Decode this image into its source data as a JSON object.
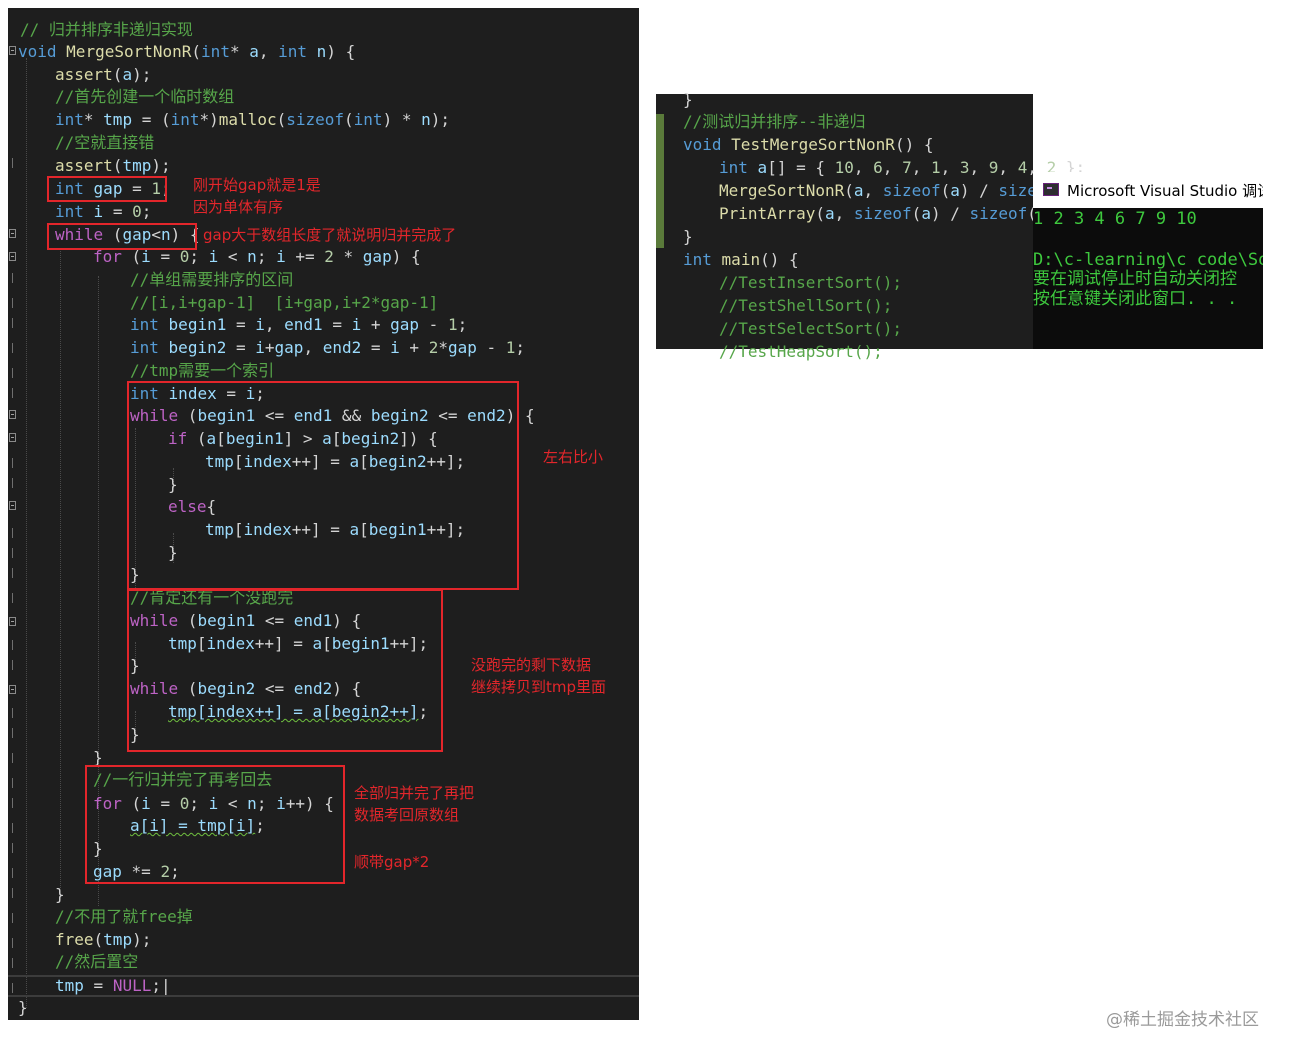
{
  "left_editor": {
    "lines": [
      {
        "parts": [
          [
            "cm",
            "// 归并排序非递归实现"
          ]
        ]
      },
      {
        "parts": [
          [
            "kw",
            "void"
          ],
          [
            "op",
            " "
          ],
          [
            "fn",
            "MergeSortNonR"
          ],
          [
            "op",
            "("
          ],
          [
            "kw",
            "int"
          ],
          [
            "op",
            "* "
          ],
          [
            "var",
            "a"
          ],
          [
            "op",
            ", "
          ],
          [
            "kw",
            "int"
          ],
          [
            "op",
            " "
          ],
          [
            "var",
            "n"
          ],
          [
            "op",
            ") {"
          ]
        ]
      },
      {
        "parts": [
          [
            "fn",
            "assert"
          ],
          [
            "op",
            "("
          ],
          [
            "var",
            "a"
          ],
          [
            "op",
            ");"
          ]
        ]
      },
      {
        "parts": [
          [
            "cm",
            "//首先创建一个临时数组"
          ]
        ]
      },
      {
        "parts": [
          [
            "kw",
            "int"
          ],
          [
            "op",
            "* "
          ],
          [
            "var",
            "tmp"
          ],
          [
            "op",
            " = ("
          ],
          [
            "kw",
            "int"
          ],
          [
            "op",
            "*)"
          ],
          [
            "fn",
            "malloc"
          ],
          [
            "op",
            "("
          ],
          [
            "kw",
            "sizeof"
          ],
          [
            "op",
            "("
          ],
          [
            "kw",
            "int"
          ],
          [
            "op",
            ") * "
          ],
          [
            "var",
            "n"
          ],
          [
            "op",
            ");"
          ]
        ]
      },
      {
        "parts": [
          [
            "cm",
            "//空就直接错"
          ]
        ]
      },
      {
        "parts": [
          [
            "fn",
            "assert"
          ],
          [
            "op",
            "("
          ],
          [
            "var",
            "tmp"
          ],
          [
            "op",
            ");"
          ]
        ]
      },
      {
        "parts": [
          [
            "kw",
            "int"
          ],
          [
            "op",
            " "
          ],
          [
            "var",
            "gap"
          ],
          [
            "op",
            " = "
          ],
          [
            "num",
            "1"
          ],
          [
            "op",
            ";"
          ]
        ]
      },
      {
        "parts": [
          [
            "kw",
            "int"
          ],
          [
            "op",
            " "
          ],
          [
            "var",
            "i"
          ],
          [
            "op",
            " = "
          ],
          [
            "num",
            "0"
          ],
          [
            "op",
            ";"
          ]
        ]
      },
      {
        "parts": [
          [
            "mac",
            "while"
          ],
          [
            "op",
            " ("
          ],
          [
            "var",
            "gap"
          ],
          [
            "op",
            "<"
          ],
          [
            "var",
            "n"
          ],
          [
            "op",
            ") {"
          ]
        ]
      },
      {
        "parts": [
          [
            "mac",
            "for"
          ],
          [
            "op",
            " ("
          ],
          [
            "var",
            "i"
          ],
          [
            "op",
            " = "
          ],
          [
            "num",
            "0"
          ],
          [
            "op",
            "; "
          ],
          [
            "var",
            "i"
          ],
          [
            "op",
            " < "
          ],
          [
            "var",
            "n"
          ],
          [
            "op",
            "; "
          ],
          [
            "var",
            "i"
          ],
          [
            "op",
            " += "
          ],
          [
            "num",
            "2"
          ],
          [
            "op",
            " * "
          ],
          [
            "var",
            "gap"
          ],
          [
            "op",
            ") {"
          ]
        ]
      },
      {
        "parts": [
          [
            "cm",
            "//单组需要排序的区间"
          ]
        ]
      },
      {
        "parts": [
          [
            "cm",
            "//[i,i+gap-1]  [i+gap,i+2*gap-1]"
          ]
        ]
      },
      {
        "parts": [
          [
            "kw",
            "int"
          ],
          [
            "op",
            " "
          ],
          [
            "var",
            "begin1"
          ],
          [
            "op",
            " = "
          ],
          [
            "var",
            "i"
          ],
          [
            "op",
            ", "
          ],
          [
            "var",
            "end1"
          ],
          [
            "op",
            " = "
          ],
          [
            "var",
            "i"
          ],
          [
            "op",
            " + "
          ],
          [
            "var",
            "gap"
          ],
          [
            "op",
            " - "
          ],
          [
            "num",
            "1"
          ],
          [
            "op",
            ";"
          ]
        ]
      },
      {
        "parts": [
          [
            "kw",
            "int"
          ],
          [
            "op",
            " "
          ],
          [
            "var",
            "begin2"
          ],
          [
            "op",
            " = "
          ],
          [
            "var",
            "i"
          ],
          [
            "op",
            "+"
          ],
          [
            "var",
            "gap"
          ],
          [
            "op",
            ", "
          ],
          [
            "var",
            "end2"
          ],
          [
            "op",
            " = "
          ],
          [
            "var",
            "i"
          ],
          [
            "op",
            " + "
          ],
          [
            "num",
            "2"
          ],
          [
            "op",
            "*"
          ],
          [
            "var",
            "gap"
          ],
          [
            "op",
            " - "
          ],
          [
            "num",
            "1"
          ],
          [
            "op",
            ";"
          ]
        ]
      },
      {
        "parts": [
          [
            "cm",
            "//tmp需要一个索引"
          ]
        ]
      },
      {
        "parts": [
          [
            "kw",
            "int"
          ],
          [
            "op",
            " "
          ],
          [
            "var",
            "index"
          ],
          [
            "op",
            " = "
          ],
          [
            "var",
            "i"
          ],
          [
            "op",
            ";"
          ]
        ]
      },
      {
        "parts": [
          [
            "mac",
            "while"
          ],
          [
            "op",
            " ("
          ],
          [
            "var",
            "begin1"
          ],
          [
            "op",
            " <= "
          ],
          [
            "var",
            "end1"
          ],
          [
            "op",
            " && "
          ],
          [
            "var",
            "begin2"
          ],
          [
            "op",
            " <= "
          ],
          [
            "var",
            "end2"
          ],
          [
            "op",
            ") {"
          ]
        ]
      },
      {
        "parts": [
          [
            "mac",
            "if"
          ],
          [
            "op",
            " ("
          ],
          [
            "var",
            "a"
          ],
          [
            "op",
            "["
          ],
          [
            "var",
            "begin1"
          ],
          [
            "op",
            "] > "
          ],
          [
            "var",
            "a"
          ],
          [
            "op",
            "["
          ],
          [
            "var",
            "begin2"
          ],
          [
            "op",
            "]) {"
          ]
        ]
      },
      {
        "parts": [
          [
            "var",
            "tmp"
          ],
          [
            "op",
            "["
          ],
          [
            "var",
            "index"
          ],
          [
            "op",
            "++] = "
          ],
          [
            "var",
            "a"
          ],
          [
            "op",
            "["
          ],
          [
            "var",
            "begin2"
          ],
          [
            "op",
            "++];"
          ]
        ]
      },
      {
        "parts": [
          [
            "op",
            "}"
          ]
        ]
      },
      {
        "parts": [
          [
            "mac",
            "else"
          ],
          [
            "op",
            "{"
          ]
        ]
      },
      {
        "parts": [
          [
            "var",
            "tmp"
          ],
          [
            "op",
            "["
          ],
          [
            "var",
            "index"
          ],
          [
            "op",
            "++] = "
          ],
          [
            "var",
            "a"
          ],
          [
            "op",
            "["
          ],
          [
            "var",
            "begin1"
          ],
          [
            "op",
            "++];"
          ]
        ]
      },
      {
        "parts": [
          [
            "op",
            "}"
          ]
        ]
      },
      {
        "parts": [
          [
            "op",
            "}"
          ]
        ]
      },
      {
        "parts": [
          [
            "cm",
            "//肯定还有一个没跑完"
          ]
        ]
      },
      {
        "parts": [
          [
            "mac",
            "while"
          ],
          [
            "op",
            " ("
          ],
          [
            "var",
            "begin1"
          ],
          [
            "op",
            " <= "
          ],
          [
            "var",
            "end1"
          ],
          [
            "op",
            ") {"
          ]
        ]
      },
      {
        "parts": [
          [
            "var",
            "tmp"
          ],
          [
            "op",
            "["
          ],
          [
            "var",
            "index"
          ],
          [
            "op",
            "++] = "
          ],
          [
            "var",
            "a"
          ],
          [
            "op",
            "["
          ],
          [
            "var",
            "begin1"
          ],
          [
            "op",
            "++];"
          ]
        ]
      },
      {
        "parts": [
          [
            "op",
            "}"
          ]
        ]
      },
      {
        "parts": [
          [
            "mac",
            "while"
          ],
          [
            "op",
            " ("
          ],
          [
            "var",
            "begin2"
          ],
          [
            "op",
            " <= "
          ],
          [
            "var",
            "end2"
          ],
          [
            "op",
            ") {"
          ]
        ]
      },
      {
        "parts": [
          [
            "sq",
            "tmp[index++] = a[begin2++]"
          ],
          [
            "op",
            ";"
          ]
        ]
      },
      {
        "parts": [
          [
            "op",
            "}"
          ]
        ]
      },
      {
        "parts": [
          [
            "op",
            "}"
          ]
        ]
      },
      {
        "parts": [
          [
            "cm",
            "//一行归并完了再考回去"
          ]
        ]
      },
      {
        "parts": [
          [
            "mac",
            "for"
          ],
          [
            "op",
            " ("
          ],
          [
            "var",
            "i"
          ],
          [
            "op",
            " = "
          ],
          [
            "num",
            "0"
          ],
          [
            "op",
            "; "
          ],
          [
            "var",
            "i"
          ],
          [
            "op",
            " < "
          ],
          [
            "var",
            "n"
          ],
          [
            "op",
            "; "
          ],
          [
            "var",
            "i"
          ],
          [
            "op",
            "++) {"
          ]
        ]
      },
      {
        "parts": [
          [
            "sq",
            "a[i] = tmp[i]"
          ],
          [
            "op",
            ";"
          ]
        ]
      },
      {
        "parts": [
          [
            "op",
            "}"
          ]
        ]
      },
      {
        "parts": [
          [
            "var",
            "gap"
          ],
          [
            "op",
            " *= "
          ],
          [
            "num",
            "2"
          ],
          [
            "op",
            ";"
          ]
        ]
      },
      {
        "parts": [
          [
            "op",
            "}"
          ]
        ]
      },
      {
        "parts": [
          [
            "cm",
            "//不用了就free掉"
          ]
        ]
      },
      {
        "parts": [
          [
            "fn",
            "free"
          ],
          [
            "op",
            "("
          ],
          [
            "var",
            "tmp"
          ],
          [
            "op",
            ");"
          ]
        ]
      },
      {
        "parts": [
          [
            "cm",
            "//然后置空"
          ]
        ]
      },
      {
        "parts": [
          [
            "var",
            "tmp"
          ],
          [
            "op",
            " = "
          ],
          [
            "mac",
            "NULL"
          ],
          [
            "op",
            ";|"
          ]
        ]
      },
      {
        "parts": [
          [
            "op",
            "}"
          ]
        ]
      }
    ]
  },
  "annotations": {
    "gap_note": "刚开始gap就是1是\n因为单体有序",
    "while_note": "gap大于数组长度了就说明归并完成了",
    "compare_note": "左右比小",
    "remaining_note": "没跑完的剩下数据\n继续拷贝到tmp里面",
    "copy_back_note": "全部归并完了再把\n数据考回原数组",
    "gap_double_note": "顺带gap*2"
  },
  "right_editor": {
    "lines": [
      {
        "parts": [
          [
            "op",
            "}"
          ]
        ]
      },
      {
        "parts": [
          [
            "cm",
            "//测试归并排序--非递归"
          ]
        ]
      },
      {
        "parts": [
          [
            "kw",
            "void"
          ],
          [
            "op",
            " "
          ],
          [
            "fn",
            "TestMergeSortNonR"
          ],
          [
            "op",
            "() {"
          ]
        ]
      },
      {
        "parts": [
          [
            "kw",
            "int"
          ],
          [
            "op",
            " "
          ],
          [
            "var",
            "a"
          ],
          [
            "op",
            "[] = { "
          ],
          [
            "num",
            "10"
          ],
          [
            "op",
            ", "
          ],
          [
            "num",
            "6"
          ],
          [
            "op",
            ", "
          ],
          [
            "num",
            "7"
          ],
          [
            "op",
            ", "
          ],
          [
            "num",
            "1"
          ],
          [
            "op",
            ", "
          ],
          [
            "num",
            "3"
          ],
          [
            "op",
            ", "
          ],
          [
            "num",
            "9"
          ],
          [
            "op",
            ", "
          ],
          [
            "num",
            "4"
          ],
          [
            "op",
            ", "
          ],
          [
            "num",
            "2"
          ],
          [
            "op",
            " };"
          ]
        ]
      },
      {
        "parts": [
          [
            "fn",
            "MergeSortNonR"
          ],
          [
            "op",
            "("
          ],
          [
            "var",
            "a"
          ],
          [
            "op",
            ", "
          ],
          [
            "kw",
            "sizeof"
          ],
          [
            "op",
            "("
          ],
          [
            "var",
            "a"
          ],
          [
            "op",
            ") / "
          ],
          [
            "kw",
            "sizeof"
          ]
        ]
      },
      {
        "parts": [
          [
            "fn",
            "PrintArray"
          ],
          [
            "op",
            "("
          ],
          [
            "var",
            "a"
          ],
          [
            "op",
            ", "
          ],
          [
            "kw",
            "sizeof"
          ],
          [
            "op",
            "("
          ],
          [
            "var",
            "a"
          ],
          [
            "op",
            ") / "
          ],
          [
            "kw",
            "sizeof"
          ],
          [
            "op",
            "("
          ],
          [
            "var",
            "a"
          ]
        ]
      },
      {
        "parts": [
          [
            "op",
            "}"
          ]
        ]
      },
      {
        "parts": [
          [
            "kw",
            "int"
          ],
          [
            "op",
            " "
          ],
          [
            "fn",
            "main"
          ],
          [
            "op",
            "() {"
          ]
        ]
      },
      {
        "parts": [
          [
            "cm",
            "//TestInsertSort();"
          ]
        ]
      },
      {
        "parts": [
          [
            "cm",
            "//TestShellSort();"
          ]
        ]
      },
      {
        "parts": [
          [
            "cm",
            "//TestSelectSort();"
          ]
        ]
      },
      {
        "parts": [
          [
            "cm",
            "//TestHeapSort();"
          ]
        ]
      }
    ]
  },
  "console": {
    "title": "Microsoft Visual Studio 调试",
    "output": "1 2 3 4 6 7 9 10",
    "path_line": "D:\\c-learning\\c code\\So",
    "msg1": "要在调试停止时自动关闭控",
    "msg2": "按任意键关闭此窗口. . ."
  },
  "watermark": "@稀土掘金技术社区",
  "colors": {
    "editor_bg": "#1e1e1e",
    "keyword": "#569cd6",
    "comment": "#57a64a",
    "function": "#dcdcaa",
    "variable": "#9cdcfe",
    "number": "#b5cea8",
    "control": "#bd63c5",
    "annotation_red": "#e3262b",
    "console_green": "#3ec93e"
  }
}
